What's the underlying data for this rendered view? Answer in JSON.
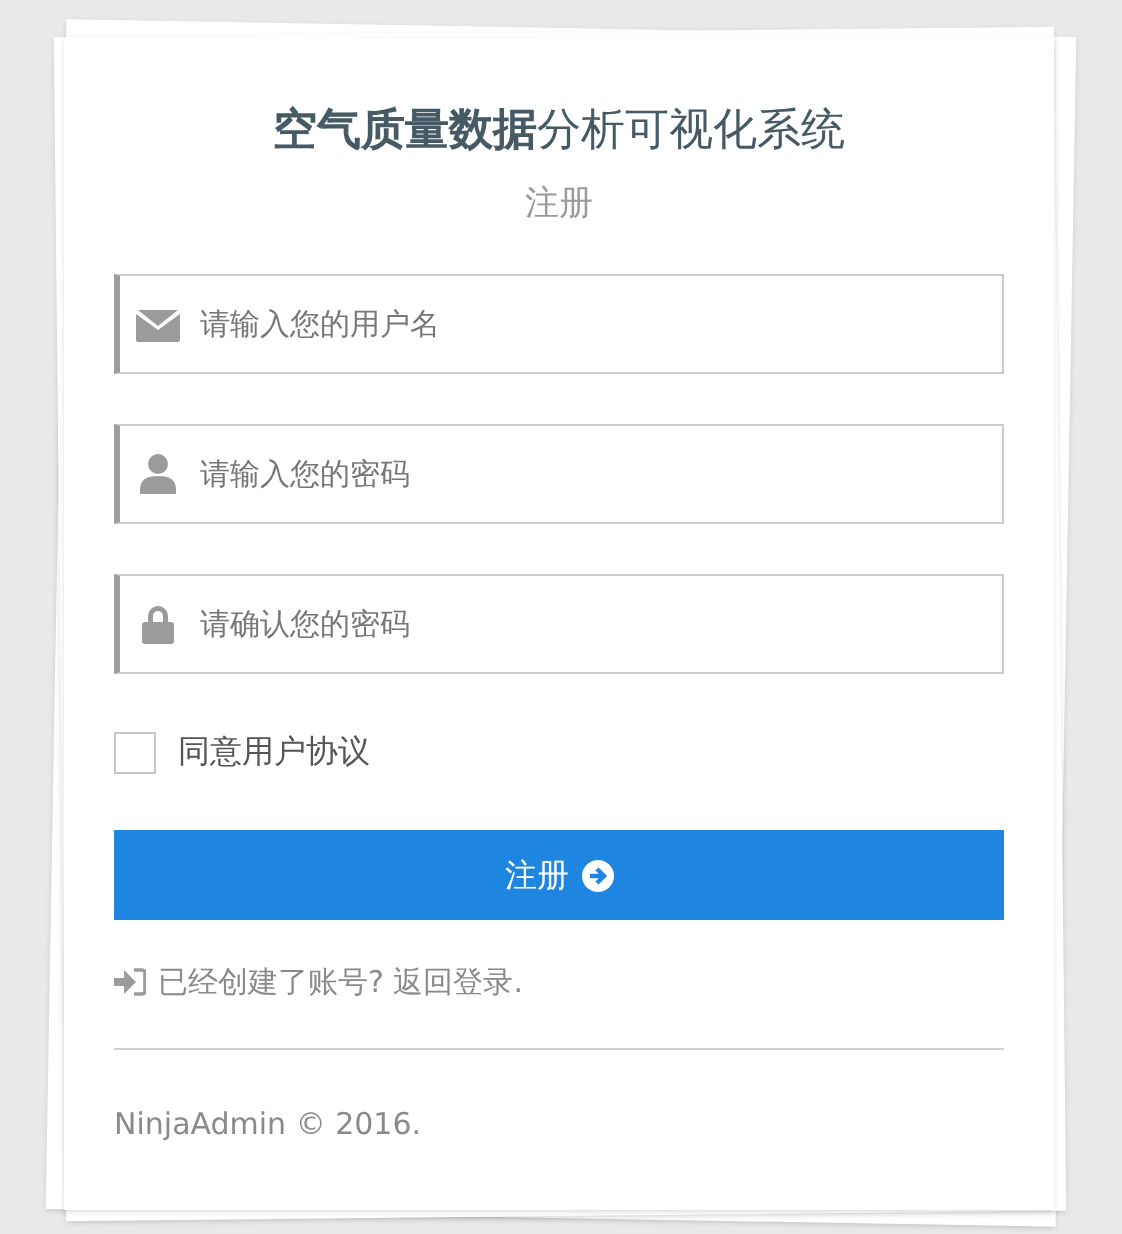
{
  "title": "**空气质量数据**分析可视化系统",
  "subtitle": "注册",
  "fields": [
    {
      "kind": "email",
      "placeholder": "请输入您的用户名"
    },
    {
      "kind": "user",
      "placeholder": "请输入您的密码"
    },
    {
      "kind": "lock",
      "placeholder": "请确认您的密码"
    }
  ],
  "agree": {
    "label": "同意用户协议",
    "checked": false
  },
  "submit": {
    "label": "注册"
  },
  "login_link": "已经创建了账号? 返回登录.",
  "footer": "NinjaAdmin © 2016."
}
